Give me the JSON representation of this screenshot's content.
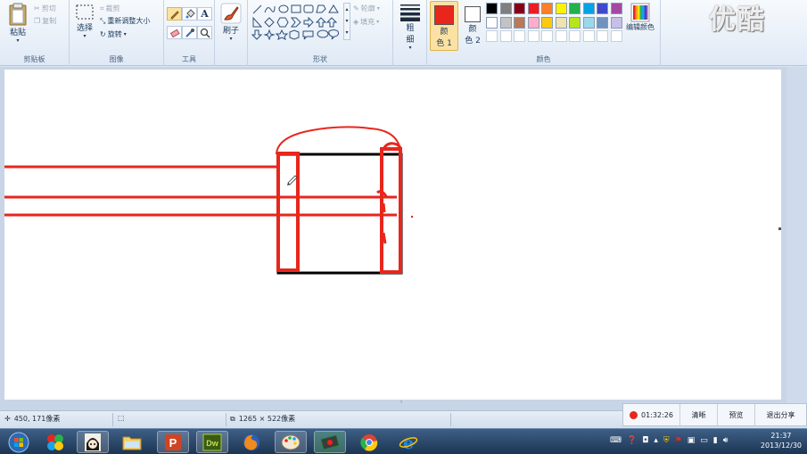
{
  "watermark": "优酷",
  "ribbon": {
    "clipboard": {
      "label": "剪贴板",
      "paste": "粘贴",
      "cut": "剪切",
      "copy": "复制"
    },
    "image": {
      "label": "图像",
      "select": "选择",
      "crop": "裁剪",
      "resize": "重新调整大小",
      "rotate": "旋转"
    },
    "tools": {
      "label": "工具"
    },
    "brushes": {
      "label": "刷子"
    },
    "shapes": {
      "label": "形状",
      "outline": "轮廓",
      "fill": "填充"
    },
    "size": {
      "label1": "粗",
      "label2": "细"
    },
    "colors": {
      "label": "颜色",
      "color1_label1": "颜",
      "color1_label2": "色 1",
      "color2_label1": "颜",
      "color2_label2": "色 2",
      "edit_colors": "编辑颜色",
      "color1": "#e8261c",
      "color2": "#ffffff",
      "palette_row1": [
        "#000000",
        "#7f7f7f",
        "#880015",
        "#ed1c24",
        "#ff7f27",
        "#fff200",
        "#22b14c",
        "#00a2e8",
        "#3f48cc",
        "#a349a4"
      ],
      "palette_row2": [
        "#ffffff",
        "#c3c3c3",
        "#b97a57",
        "#ffaec9",
        "#ffc90e",
        "#efe4b0",
        "#b5e61d",
        "#99d9ea",
        "#7092be",
        "#c8bfe7"
      ]
    }
  },
  "status": {
    "cursor_pos": "450, 171像素",
    "selection": "",
    "canvas_size": "1265 × 522像素"
  },
  "recorder": {
    "time": "01:32:26",
    "quality": "清晰",
    "preview": "预览",
    "exit": "退出分享"
  },
  "taskbar": {
    "apps": [
      "start",
      "pinwheel",
      "character",
      "explorer",
      "powerpoint",
      "dreamweaver",
      "firefox",
      "paint",
      "media",
      "chrome",
      "ie"
    ],
    "clock_time": "21:37",
    "clock_date": "2013/12/30"
  }
}
